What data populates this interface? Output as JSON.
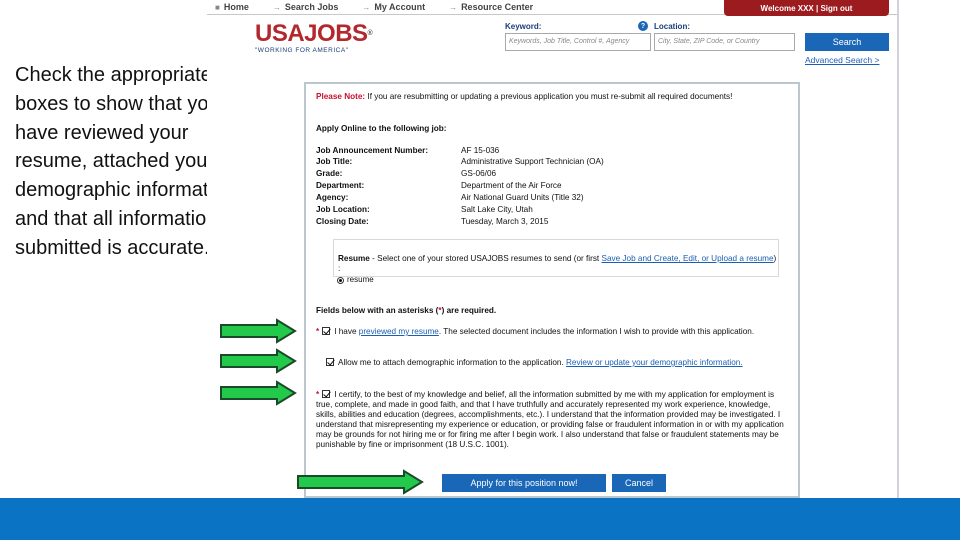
{
  "slide": {
    "instruction": "Check the appropriate boxes to show that you have reviewed your resume, attached your demographic information and that all information submitted is accurate."
  },
  "nav": {
    "items": [
      {
        "label": "Home"
      },
      {
        "label": "Search Jobs"
      },
      {
        "label": "My Account"
      },
      {
        "label": "Resource Center"
      }
    ],
    "welcome": "Welcome XXX | Sign out"
  },
  "logo": {
    "word": "USAJOBS",
    "tagline": "\"WORKING FOR AMERICA\""
  },
  "search": {
    "keyword_label": "Keyword:",
    "keyword_placeholder": "Keywords, Job Title, Control #, Agency",
    "location_label": "Location:",
    "location_placeholder": "City, State, ZIP Code, or Country",
    "button": "Search",
    "advanced": "Advanced Search >"
  },
  "application": {
    "note_label": "Please Note:",
    "note_text": " If you are resubmitting or updating a previous application you must re-submit all required documents!",
    "apply_online": "Apply Online to the following job:",
    "fields": [
      {
        "label": "Job Announcement Number:",
        "value": "AF 15-036"
      },
      {
        "label": "Job Title:",
        "value": "Administrative Support Technician (OA)"
      },
      {
        "label": "Grade:",
        "value": "GS-06/06"
      },
      {
        "label": "Department:",
        "value": "Department of the Air Force"
      },
      {
        "label": "Agency:",
        "value": "Air National Guard Units (Title 32)"
      },
      {
        "label": "Job Location:",
        "value": "Salt Lake City, Utah"
      },
      {
        "label": "Closing Date:",
        "value": "Tuesday, March 3, 2015"
      }
    ],
    "resume": {
      "prefix": "Resume",
      "text": " - Select one of your stored USAJOBS resumes to send (or first ",
      "link1": "Save Job and Create, Edit, or Upload a resume",
      "suffix": ") :",
      "option": "resume"
    },
    "required_note_before": "Fields below with an asterisks (",
    "required_star": "*",
    "required_note_after": ") are required.",
    "check1": {
      "star": "*",
      "before": "I have ",
      "link": "previewed my resume",
      "after": ". The selected document includes the information I wish to provide with this application."
    },
    "check2": {
      "text": "Allow me to attach demographic information to the application. ",
      "link": "Review or update your demographic information."
    },
    "check3": {
      "star": "*",
      "text": "I certify, to the best of my knowledge and belief, all the information submitted by me with my application for employment is true, complete, and made in good faith, and that I have truthfully and accurately represented my work experience, knowledge, skills, abilities and education (degrees, accomplishments, etc.). I understand that the information provided may be investigated. I understand that misrepresenting my experience or education, or providing false or fraudulent information in or with my application may be grounds for not hiring me or for firing me after I begin work. I also understand that false or fraudulent statements may be punishable by fine or imprisonment (18 U.S.C. 1001)."
    },
    "apply_button": "Apply for this position now!",
    "cancel_button": "Cancel"
  },
  "colors": {
    "arrow_fill": "#22c94a",
    "arrow_stroke": "#1b4a2a",
    "brand_red": "#b3282d",
    "button_blue": "#1a66b7",
    "footer_blue": "#0a73c4"
  }
}
